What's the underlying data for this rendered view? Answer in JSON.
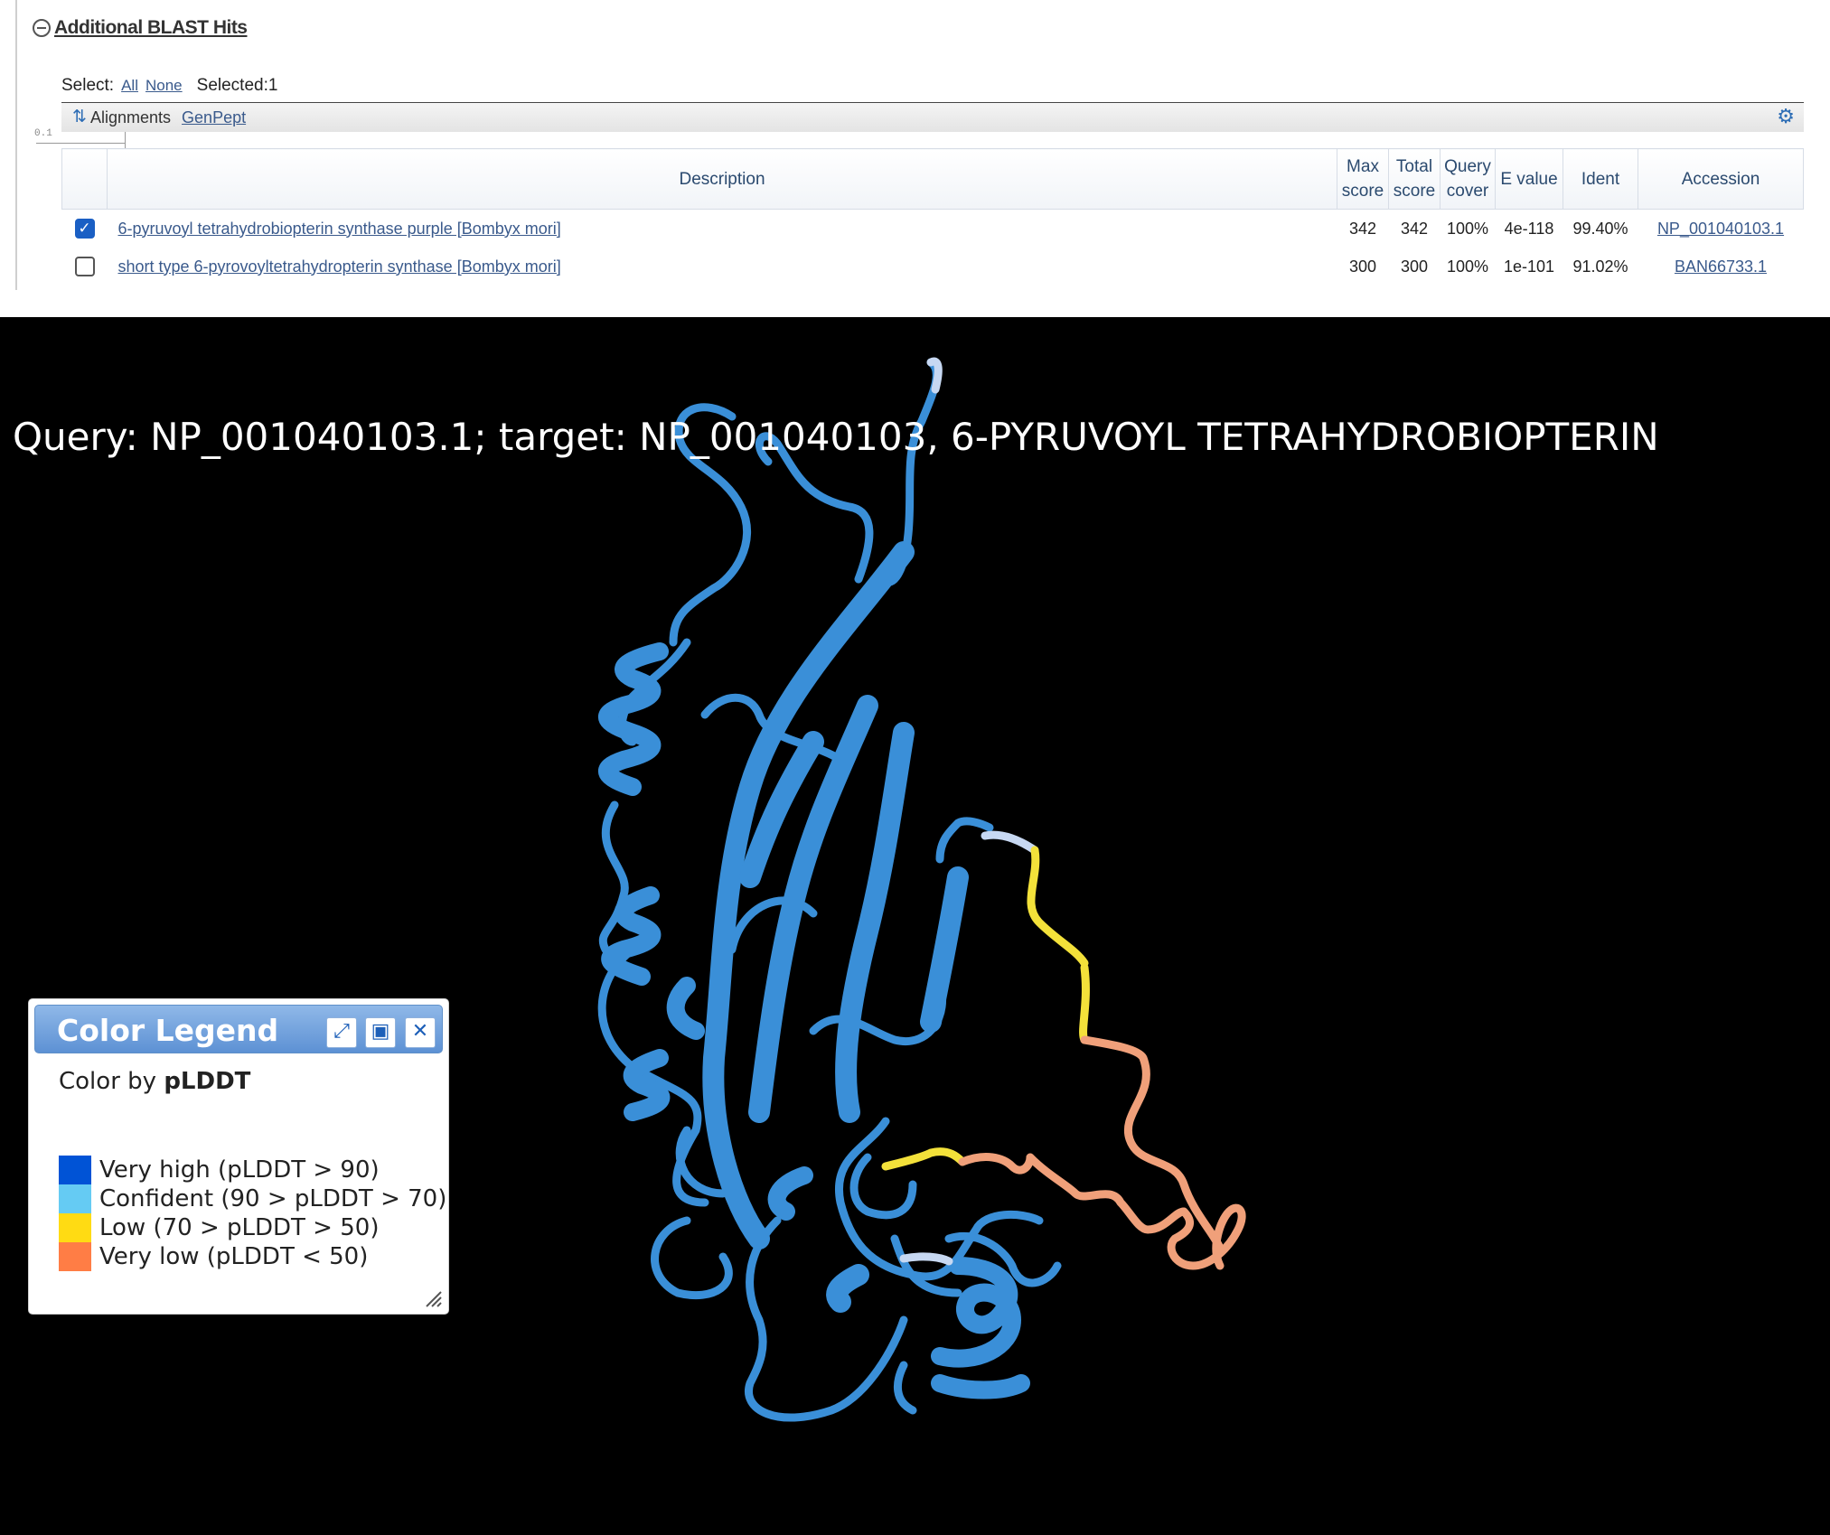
{
  "section": {
    "title": "Additional BLAST Hits"
  },
  "select_bar": {
    "label": "Select:",
    "all": "All",
    "none": "None",
    "selected": "Selected:1"
  },
  "toolbar": {
    "alignments": "Alignments",
    "genpept": "GenPept"
  },
  "scale": {
    "tick": "0.1"
  },
  "table": {
    "headers": {
      "description": "Description",
      "max_score_1": "Max",
      "max_score_2": "score",
      "total_score_1": "Total",
      "total_score_2": "score",
      "query_cover_1": "Query",
      "query_cover_2": "cover",
      "e_value": "E value",
      "ident": "Ident",
      "accession": "Accession"
    },
    "rows": [
      {
        "checked": true,
        "description": "6-pyruvoyl tetrahydrobiopterin synthase purple [Bombyx mori]",
        "max_score": "342",
        "total_score": "342",
        "query_cover": "100%",
        "e_value": "4e-118",
        "ident": "99.40%",
        "accession": "NP_001040103.1"
      },
      {
        "checked": false,
        "description": "short type 6-pyrovoyltetrahydropterin synthase [Bombyx mori]",
        "max_score": "300",
        "total_score": "300",
        "query_cover": "100%",
        "e_value": "1e-101",
        "ident": "91.02%",
        "accession": "BAN66733.1"
      }
    ]
  },
  "viewer": {
    "title": "Query: NP_001040103.1; target: NP_001040103, 6-PYRUVOYL TETRAHYDROBIOPTERIN",
    "background": "#000000",
    "structure_color": "#3a8fd8"
  },
  "legend": {
    "title": "Color Legend",
    "subtitle_prefix": "Color by",
    "subtitle_metric": "pLDDT",
    "items": [
      {
        "label": "Very high (pLDDT > 90)",
        "color": "#0053d6"
      },
      {
        "label": "Confident (90 > pLDDT > 70)",
        "color": "#65cbf3"
      },
      {
        "label": "Low (70 > pLDDT > 50)",
        "color": "#ffdb13"
      },
      {
        "label": "Very low (pLDDT < 50)",
        "color": "#ff7d45"
      }
    ],
    "icons": [
      "expand-icon",
      "save-icon",
      "close-icon"
    ]
  }
}
